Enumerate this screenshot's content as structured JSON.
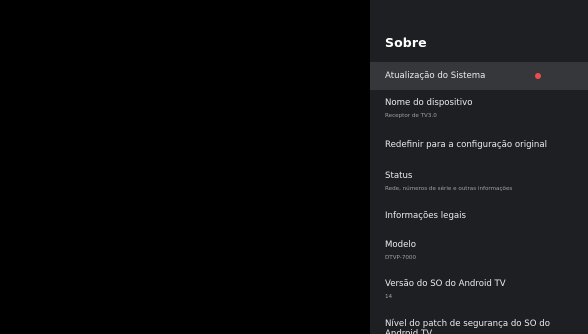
{
  "panel": {
    "title": "Sobre",
    "items": [
      {
        "title": "Atualização do Sistema",
        "subtitle": "",
        "focused": true,
        "notification_color": "#ee4b4b"
      },
      {
        "title": "Nome do dispositivo",
        "subtitle": "Receptor de TV3.0"
      },
      {
        "title": "Redefinir para a configuração original",
        "subtitle": ""
      },
      {
        "title": "Status",
        "subtitle": "Rede, números de série e outras informações"
      },
      {
        "title": "Informações legais",
        "subtitle": ""
      },
      {
        "title": "Modelo",
        "subtitle": "DTVP-7000"
      },
      {
        "title": "Versão do SO do Android TV",
        "subtitle": "14"
      },
      {
        "title": "Nível do patch de segurança do SO do Android TV",
        "subtitle": ""
      }
    ]
  },
  "colors": {
    "panel_background": "#1d1f22",
    "focused_background": "#35373b",
    "notification_dot": "#ee4b4b"
  }
}
